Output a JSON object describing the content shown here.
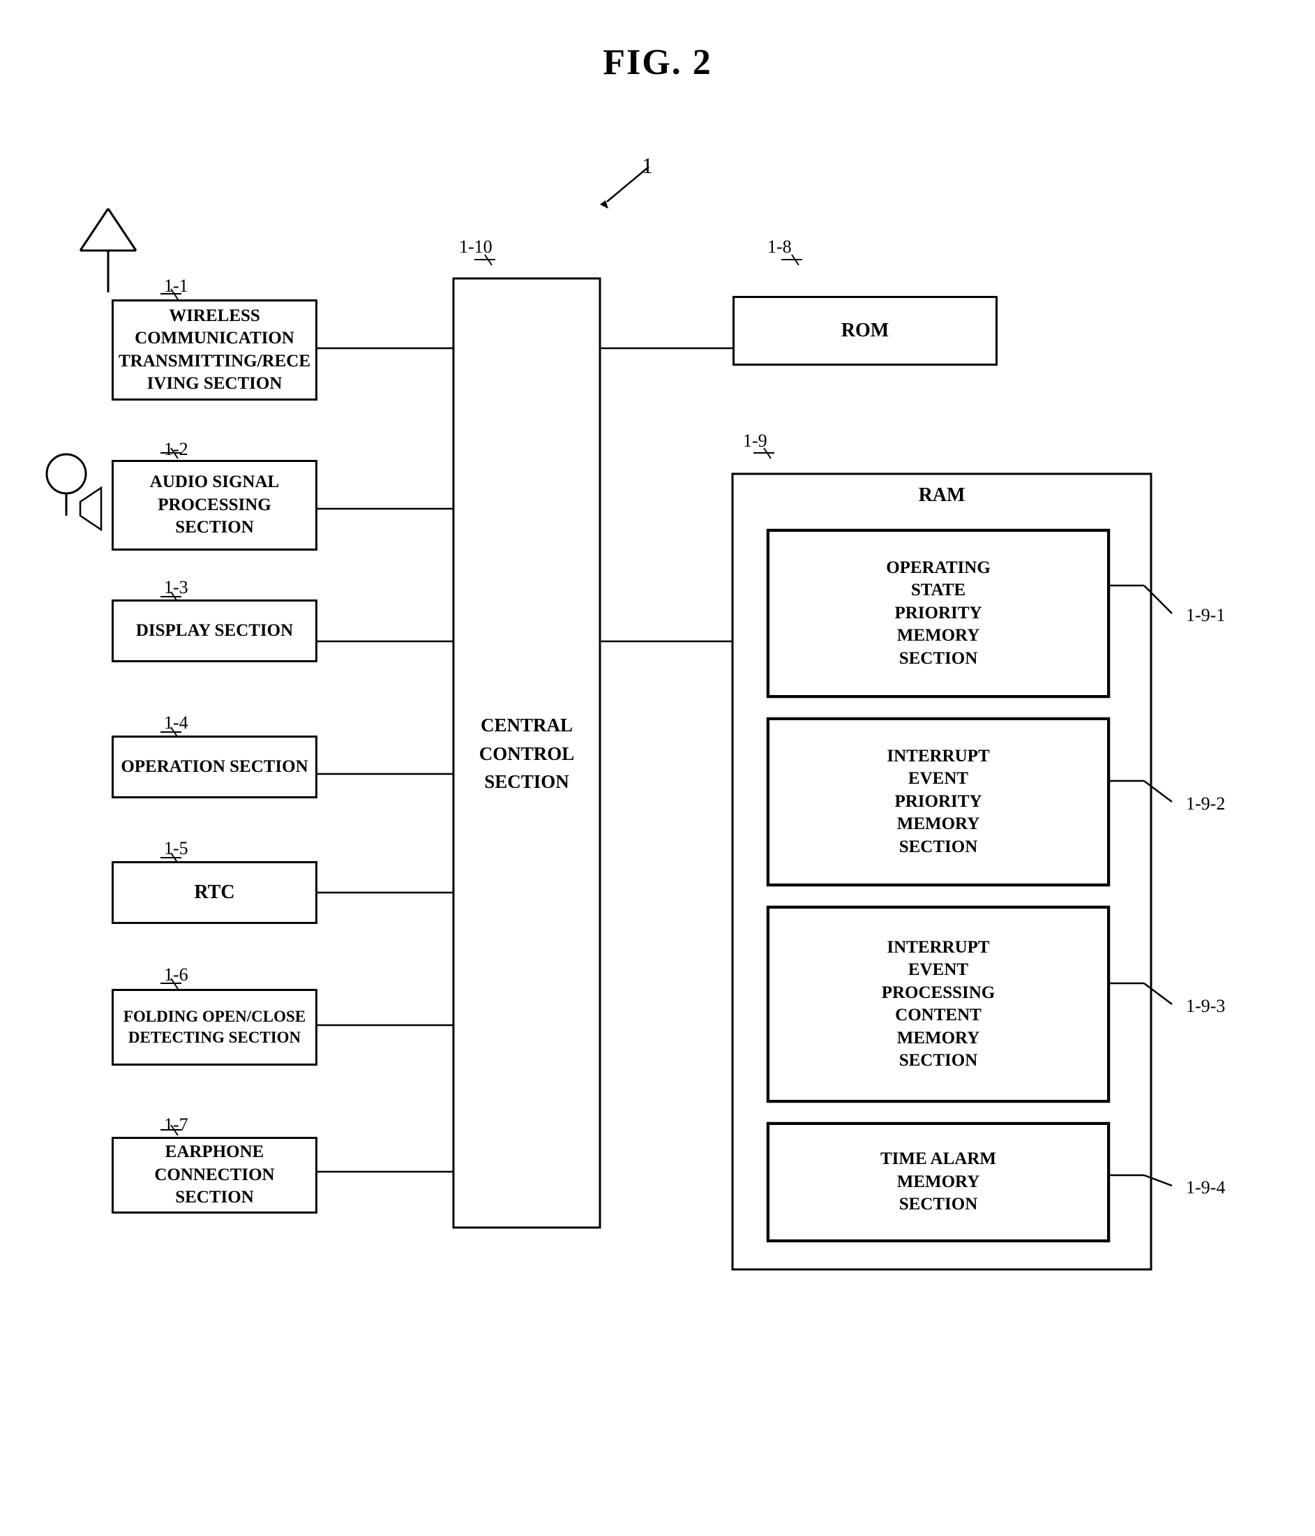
{
  "title": "FIG. 2",
  "diagram_label": "1",
  "components": {
    "wireless": {
      "label": "1-1",
      "text": "WIRELESS\nCOMMUNICATION\nTRANSMITTING/RECE\nIVING SECTION"
    },
    "audio": {
      "label": "1-2",
      "text": "AUDIO SIGNAL\nPROCESSING\nSECTION"
    },
    "display": {
      "label": "1-3",
      "text": "DISPLAY SECTION"
    },
    "operation": {
      "label": "1-4",
      "text": "OPERATION SECTION"
    },
    "rtc": {
      "label": "1-5",
      "text": "RTC"
    },
    "folding": {
      "label": "1-6",
      "text": "FOLDING OPEN/CLOSE\nDETECTING SECTION"
    },
    "earphone": {
      "label": "1-7",
      "text": "EARPHONE\nCONNECTION SECTION"
    },
    "central": {
      "label": "1-10",
      "text": "CENTRAL\nCONTROL\nSECTION"
    },
    "rom": {
      "label": "1-8",
      "text": "ROM"
    },
    "ram": {
      "label": "1-9",
      "text": "RAM",
      "subsections": {
        "s1": {
          "label": "1-9-1",
          "text": "OPERATING\nSTATE\nPRIORITY\nMEMORY\nSECTION"
        },
        "s2": {
          "label": "1-9-2",
          "text": "INTERRUPT\nEVENT\nPRIORITY\nMEMORY\nSECTION"
        },
        "s3": {
          "label": "1-9-3",
          "text": "INTERRUPT\nEVENT\nPROCESSING\nCONTENT\nMEMORY\nSECTION"
        },
        "s4": {
          "label": "1-9-4",
          "text": "TIME ALARM\nMEMORY\nSECTION"
        }
      }
    }
  }
}
